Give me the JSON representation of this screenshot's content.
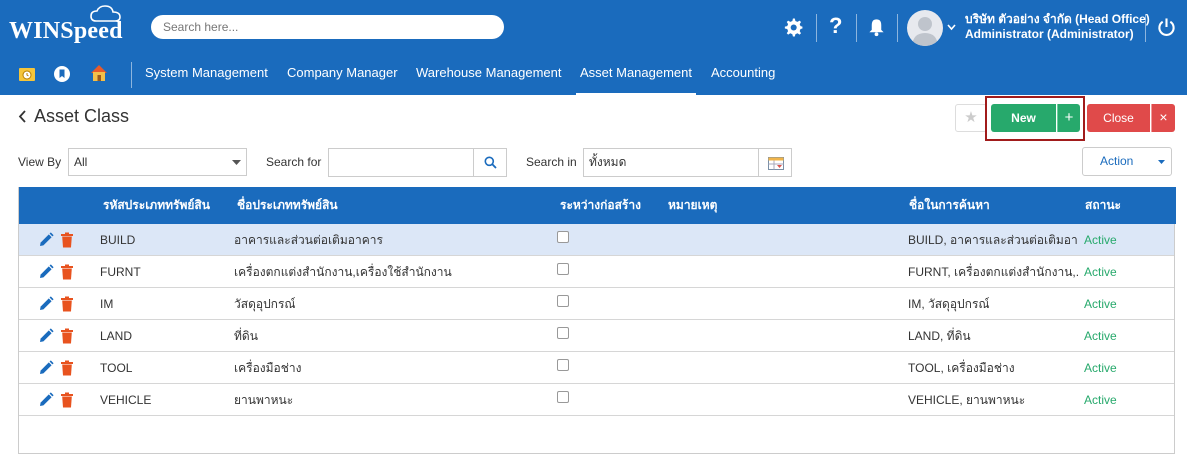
{
  "app": {
    "logo_text": "WINSpeed"
  },
  "search": {
    "placeholder": "Search here..."
  },
  "user": {
    "company": "บริษัท ตัวอย่าง จำกัด (Head Office)",
    "name": "Administrator (Administrator)"
  },
  "colors": {
    "brand": "#1a6bbd",
    "new": "#27a96c",
    "close": "#e04a4a",
    "active": "#27a96c",
    "selected_row": "#dce7f7"
  },
  "icons": {
    "top": [
      "gear-icon",
      "question-icon",
      "bell-icon",
      "avatar",
      "chevron-down-icon",
      "power-icon"
    ],
    "quick": [
      "folder-clock-icon",
      "bookmark-icon",
      "home-icon"
    ]
  },
  "nav": {
    "items": [
      "System Management",
      "Company Manager",
      "Warehouse Management",
      "Asset Management",
      "Accounting"
    ],
    "active": "Asset Management"
  },
  "page": {
    "title": "Asset Class"
  },
  "toolbar": {
    "new_label": "New",
    "new_plus": "+",
    "close_label": "Close",
    "close_x": "×",
    "star": "★"
  },
  "filters": {
    "view_by_label": "View By",
    "view_by_value": "All",
    "search_for_label": "Search for",
    "search_for_value": "",
    "search_in_label": "Search in",
    "search_in_value": "ทั้งหมด",
    "action_label": "Action"
  },
  "grid": {
    "columns": [
      "รหัสประเภททรัพย์สิน",
      "ชื่อประเภททรัพย์สิน",
      "ระหว่างก่อสร้าง",
      "หมายเหตุ",
      "ชื่อในการค้นหา",
      "สถานะ"
    ],
    "rows": [
      {
        "code": "BUILD",
        "name": "อาคารและส่วนต่อเติมอาคาร",
        "under_construction": false,
        "remark": "",
        "search_name": "BUILD, อาคารและส่วนต่อเติมอา...",
        "status": "Active",
        "selected": true
      },
      {
        "code": "FURNT",
        "name": "เครื่องตกแต่งสำนักงาน,เครื่องใช้สำนักงาน",
        "under_construction": false,
        "remark": "",
        "search_name": "FURNT, เครื่องตกแต่งสำนักงาน,...",
        "status": "Active",
        "selected": false
      },
      {
        "code": "IM",
        "name": "วัสดุอุปกรณ์",
        "under_construction": false,
        "remark": "",
        "search_name": "IM, วัสดุอุปกรณ์",
        "status": "Active",
        "selected": false
      },
      {
        "code": "LAND",
        "name": "ที่ดิน",
        "under_construction": false,
        "remark": "",
        "search_name": "LAND, ที่ดิน",
        "status": "Active",
        "selected": false
      },
      {
        "code": "TOOL",
        "name": "เครื่องมือช่าง",
        "under_construction": false,
        "remark": "",
        "search_name": "TOOL, เครื่องมือช่าง",
        "status": "Active",
        "selected": false
      },
      {
        "code": "VEHICLE",
        "name": "ยานพาหนะ",
        "under_construction": false,
        "remark": "",
        "search_name": "VEHICLE, ยานพาหนะ",
        "status": "Active",
        "selected": false
      }
    ]
  }
}
